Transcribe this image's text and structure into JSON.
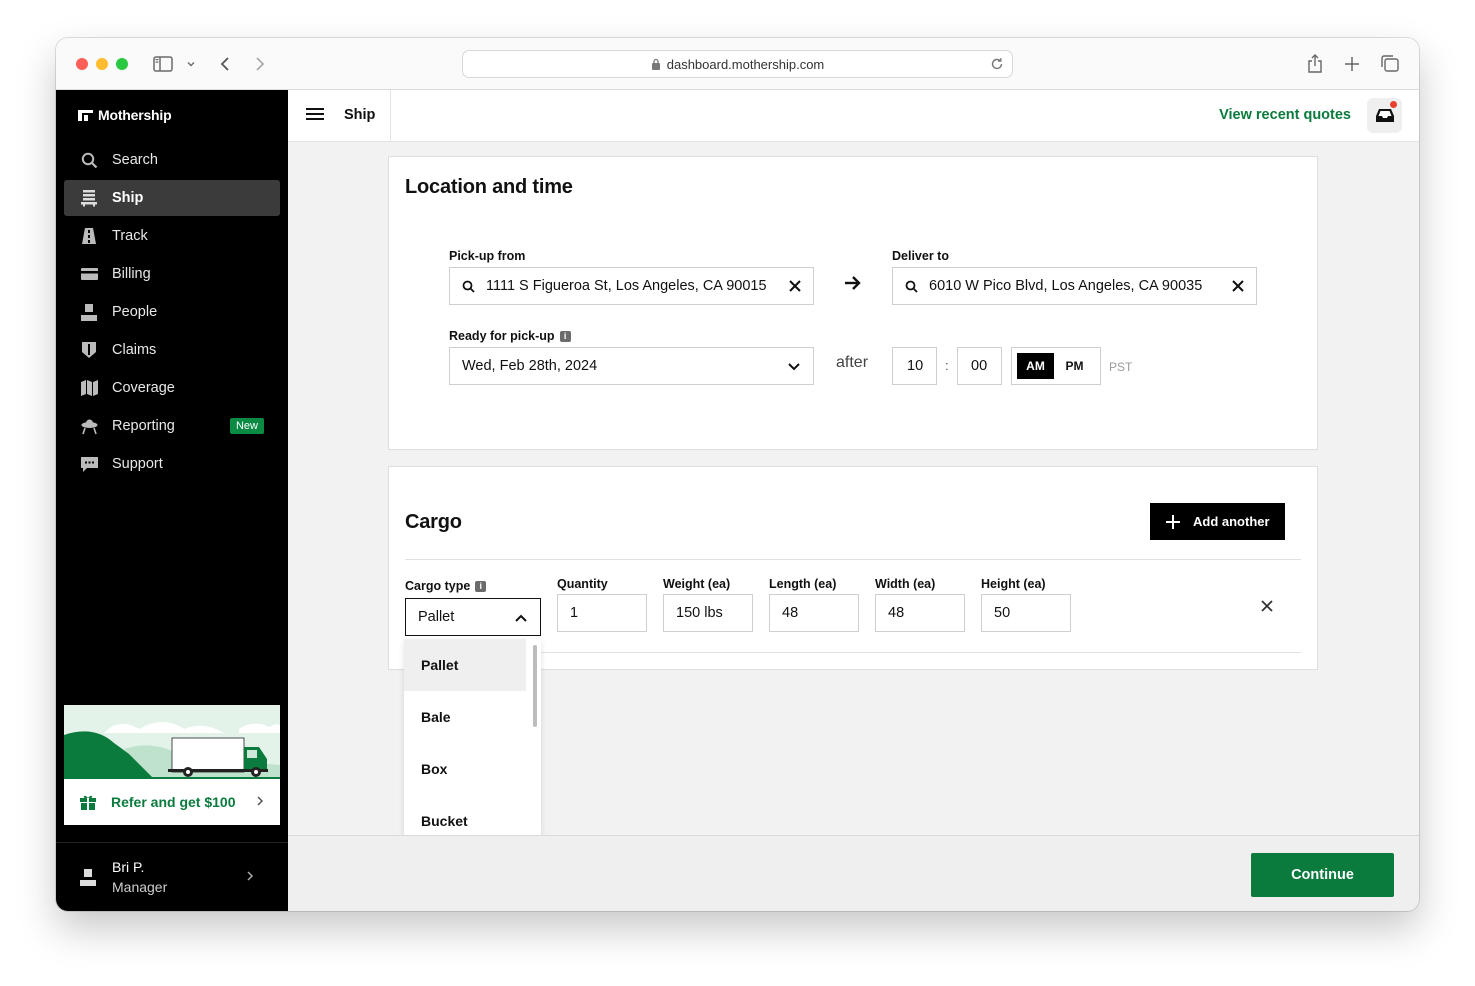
{
  "browser": {
    "url": "dashboard.mothership.com"
  },
  "brand": {
    "name": "Mothership",
    "accent": "#0a7a3d"
  },
  "sidebar": {
    "items": [
      {
        "label": "Search",
        "icon": "search-icon"
      },
      {
        "label": "Ship",
        "icon": "ship-icon",
        "active": true
      },
      {
        "label": "Track",
        "icon": "track-icon"
      },
      {
        "label": "Billing",
        "icon": "billing-icon"
      },
      {
        "label": "People",
        "icon": "people-icon"
      },
      {
        "label": "Claims",
        "icon": "claims-icon"
      },
      {
        "label": "Coverage",
        "icon": "coverage-icon"
      },
      {
        "label": "Reporting",
        "icon": "reporting-icon",
        "badge": "New"
      },
      {
        "label": "Support",
        "icon": "support-icon"
      }
    ],
    "refer": {
      "label": "Refer and get $100"
    },
    "user": {
      "name": "Bri P.",
      "role": "Manager"
    }
  },
  "topbar": {
    "title": "Ship",
    "recent_quotes": "View recent quotes"
  },
  "location": {
    "title": "Location and time",
    "pickup_label": "Pick-up from",
    "pickup_value": "1111 S Figueroa St, Los Angeles, CA 90015",
    "deliver_label": "Deliver to",
    "deliver_value": "6010 W Pico Blvd, Los Angeles, CA 90035",
    "ready_label": "Ready for pick-up",
    "date_value": "Wed, Feb 28th, 2024",
    "after_label": "after",
    "hour": "10",
    "separator": ":",
    "minute": "00",
    "am": "AM",
    "pm": "PM",
    "timezone": "PST"
  },
  "cargo": {
    "title": "Cargo",
    "add_label": "Add another",
    "type_label": "Cargo type",
    "type_value": "Pallet",
    "quantity_label": "Quantity",
    "quantity_value": "1",
    "weight_label": "Weight (ea)",
    "weight_value": "150 lbs",
    "length_label": "Length (ea)",
    "length_value": "48",
    "width_label": "Width (ea)",
    "width_value": "48",
    "height_label": "Height (ea)",
    "height_value": "50",
    "options": [
      "Pallet",
      "Bale",
      "Box",
      "Bucket"
    ]
  },
  "footer": {
    "continue_label": "Continue"
  }
}
